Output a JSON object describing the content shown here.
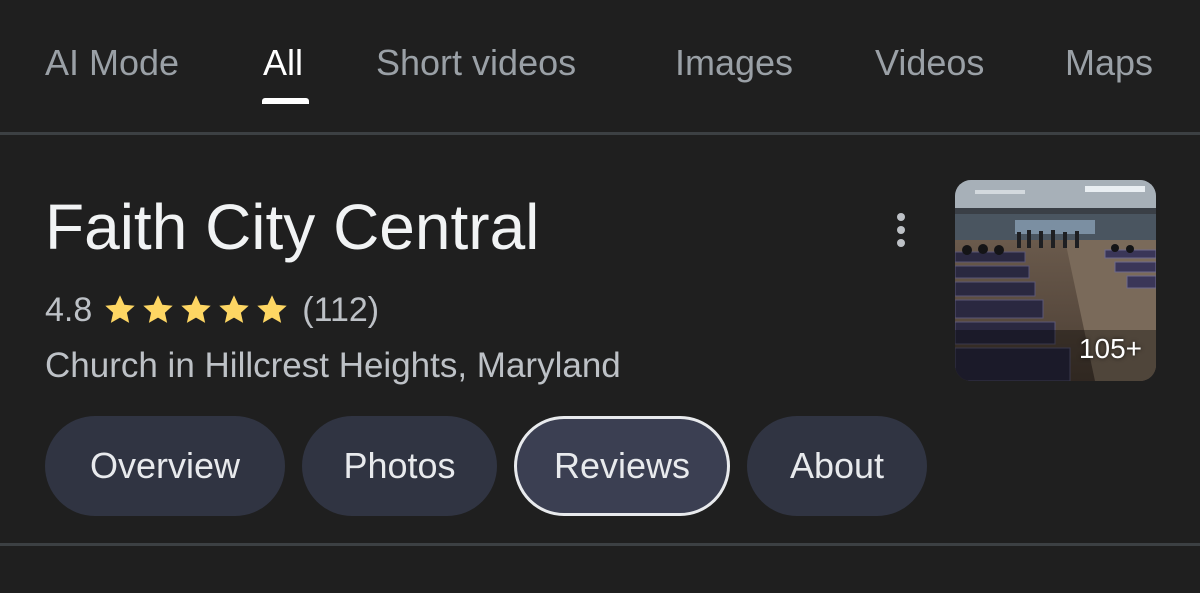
{
  "tabs": [
    {
      "label": "AI Mode",
      "active": false
    },
    {
      "label": "All",
      "active": true
    },
    {
      "label": "Short videos",
      "active": false
    },
    {
      "label": "Images",
      "active": false
    },
    {
      "label": "Videos",
      "active": false
    },
    {
      "label": "Maps",
      "active": false
    }
  ],
  "place": {
    "name": "Faith City Central",
    "rating": "4.8",
    "stars": 5,
    "review_count": "(112)",
    "category_location": "Church in Hillcrest Heights, Maryland"
  },
  "thumbnail": {
    "photo_count": "105+"
  },
  "chips": [
    {
      "label": "Overview",
      "selected": false
    },
    {
      "label": "Photos",
      "selected": false
    },
    {
      "label": "Reviews",
      "selected": true
    },
    {
      "label": "About",
      "selected": false
    }
  ],
  "icons": {
    "more": "more-vert-icon",
    "star": "star-icon"
  },
  "colors": {
    "background": "#1f1f1f",
    "star": "#fdd663",
    "chip": "#303442",
    "tab_inactive": "#9aa0a6",
    "tab_active": "#ffffff"
  }
}
